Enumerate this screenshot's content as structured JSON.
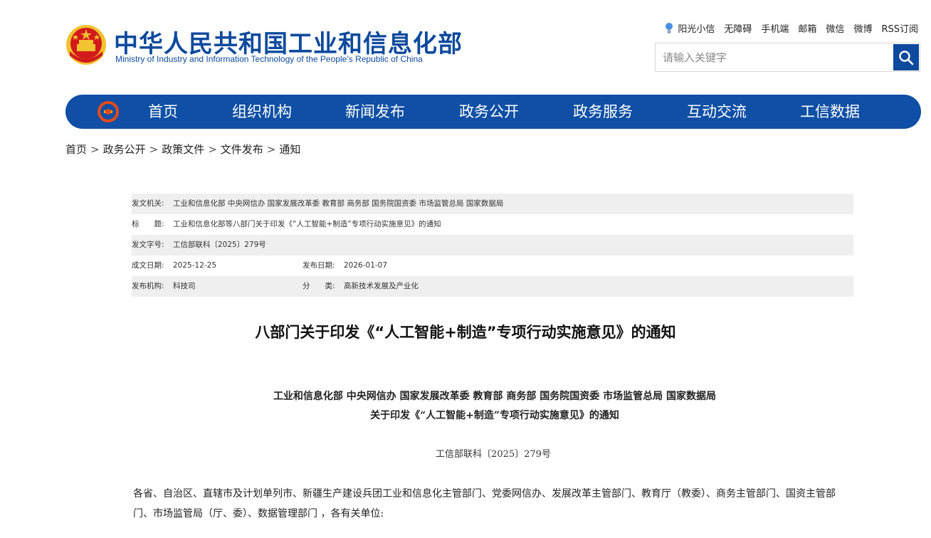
{
  "header": {
    "title_cn": "中华人民共和国工业和信息化部",
    "title_en": "Ministry of Industry and Information Technology of the People’s Republic of China",
    "emblem_icon": "national-emblem-icon",
    "top_links": [
      "阳光小信",
      "无障碍",
      "手机端",
      "邮箱",
      "微信",
      "微博",
      "RSS订阅"
    ],
    "search_placeholder": "请输入关键字"
  },
  "nav": {
    "items": [
      "首页",
      "组织机构",
      "新闻发布",
      "政务公开",
      "政务服务",
      "互动交流",
      "工信数据"
    ],
    "bg_color": "#0f4fa5"
  },
  "breadcrumb": [
    "首页",
    "政务公开",
    "政策文件",
    "文件发布",
    "通知"
  ],
  "info": {
    "issuer_label": "发文机关:",
    "issuer_value": "工业和信息化部 中央网信办 国家发展改革委 教育部 商务部 国务院国资委 市场监管总局 国家数据局",
    "title_label": "标　　题:",
    "title_value": "工业和信息化部等八部门关于印发《“人工智能+制造”专项行动实施意见》的通知",
    "docno_label": "发文字号:",
    "docno_value": "工信部联科〔2025〕279号",
    "date_label": "成文日期:",
    "date_value": "2025-12-25",
    "pubdate_label": "发布日期:",
    "pubdate_value": "2026-01-07",
    "org_label": "发布机构:",
    "org_value": "科技司",
    "category_label": "分　　类:",
    "category_value": "高新技术发展及产业化"
  },
  "article": {
    "title": "八部门关于印发《“人工智能+制造”专项行动实施意见》的通知",
    "subtitle_line1": "工业和信息化部 中央网信办 国家发展改革委 教育部 商务部 国务院国资委 市场监管总局 国家数据局",
    "subtitle_line2": "关于印发《“人工智能+制造”专项行动实施意见》的通知",
    "doc_number": "工信部联科〔2025〕279号",
    "body": "各省、自治区、直辖市及计划单列市、新疆生产建设兵团工业和信息化主管部门、党委网信办、发展改革主管部门、教育厅（教委）、商务主管部门、国资主管部门、市场监管局（厅、委）、数据管理部门 ，各有关单位:"
  },
  "colors": {
    "brand_blue": "#0d4a9e",
    "emblem_red": "#d21a1a",
    "emblem_gold": "#f2c230"
  }
}
